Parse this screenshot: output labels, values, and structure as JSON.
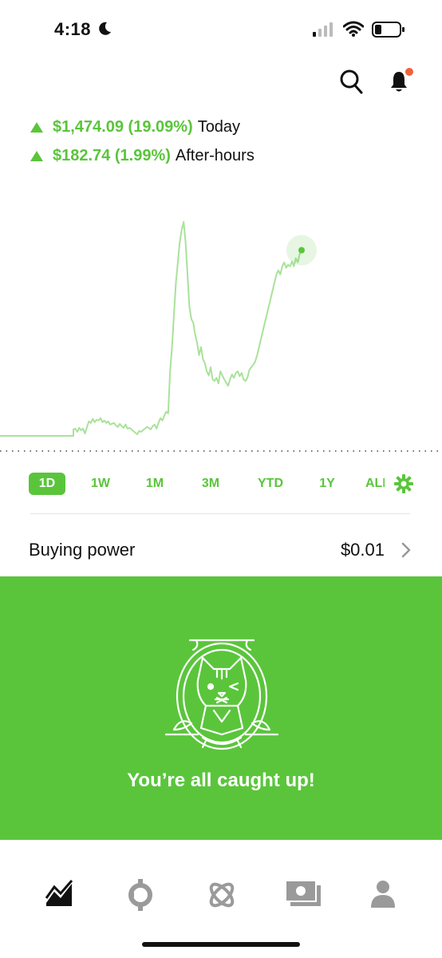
{
  "status_bar": {
    "time": "4:18"
  },
  "portfolio": {
    "today_change": "$1,474.09 (19.09%)",
    "today_label": "Today",
    "after_hours_change": "$182.74 (1.99%)",
    "after_hours_label": "After-hours",
    "accent_color": "#5ac53b"
  },
  "ranges": [
    "1D",
    "1W",
    "1M",
    "3M",
    "YTD",
    "1Y",
    "ALL"
  ],
  "active_range": "1D",
  "buying_power": {
    "label": "Buying power",
    "value": "$0.01"
  },
  "notice": {
    "text": "You’re all caught up!"
  },
  "tabs": [
    {
      "name": "investing",
      "icon": "line-chart-icon",
      "active": true
    },
    {
      "name": "crypto",
      "icon": "crypto-icon",
      "active": false
    },
    {
      "name": "browse",
      "icon": "atom-icon",
      "active": false
    },
    {
      "name": "cash",
      "icon": "cash-icon",
      "active": false
    },
    {
      "name": "account",
      "icon": "person-icon",
      "active": false
    }
  ],
  "chart_data": {
    "type": "line",
    "series": [
      {
        "values": [
          0,
          0,
          0,
          0,
          0,
          0,
          0,
          0,
          0,
          0,
          0,
          0,
          0,
          0,
          0,
          0,
          0,
          0,
          0,
          0,
          0,
          0,
          0,
          0,
          0,
          0,
          0,
          0,
          0,
          0,
          0,
          0,
          0,
          0,
          0,
          0,
          0,
          0,
          0,
          0,
          0,
          0,
          0,
          0,
          0,
          0,
          0,
          0,
          8,
          9,
          5,
          10,
          7,
          9,
          3,
          11,
          18,
          16,
          21,
          17,
          20,
          19,
          22,
          17,
          19,
          16,
          18,
          14,
          15,
          16,
          13,
          11,
          15,
          12,
          10,
          14,
          9,
          10,
          8,
          6,
          4,
          2,
          6,
          5,
          7,
          9,
          11,
          10,
          8,
          12,
          14,
          9,
          16,
          22,
          19,
          25,
          30,
          28,
          80,
          110,
          150,
          190,
          215,
          240,
          255,
          265,
          240,
          200,
          160,
          145,
          140,
          125,
          115,
          100,
          110,
          95,
          90,
          80,
          75,
          85,
          70,
          68,
          72,
          65,
          80,
          75,
          70,
          66,
          62,
          70,
          76,
          72,
          78,
          80,
          74,
          78,
          70,
          68,
          72,
          82,
          85,
          88,
          92,
          100,
          110,
          120,
          130,
          140,
          150,
          160,
          170,
          180,
          190,
          200,
          205,
          200,
          210,
          215,
          208,
          212,
          210,
          216,
          210,
          220,
          215,
          225,
          230
        ]
      }
    ],
    "grid": false
  }
}
